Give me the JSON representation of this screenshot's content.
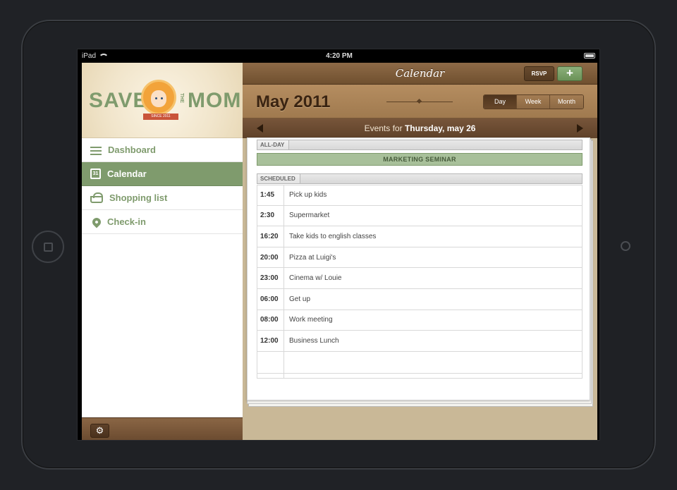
{
  "statusbar": {
    "carrier": "iPad",
    "time": "4:20 PM"
  },
  "logo": {
    "word_left": "SAVE",
    "word_the": "THE",
    "word_right": "MOM",
    "ribbon": "SINCE 2011"
  },
  "sidebar": {
    "items": [
      {
        "label": "Dashboard",
        "icon": "list-icon",
        "active": false
      },
      {
        "label": "Calendar",
        "icon": "calendar-icon",
        "icon_text": "31",
        "active": true
      },
      {
        "label": "Shopping list",
        "icon": "basket-icon",
        "active": false
      },
      {
        "label": "Check-in",
        "icon": "location-pin-icon",
        "active": false
      }
    ],
    "footer_icon": "gear-icon"
  },
  "header": {
    "title": "Calendar",
    "rsvp_label": "RSVP",
    "add_label": "+"
  },
  "month": {
    "title": "May 2011",
    "views": [
      "Day",
      "Week",
      "Month"
    ],
    "selected_view": "Day"
  },
  "events_bar": {
    "prefix": "Events for",
    "date": "Thursday, may 26"
  },
  "allday": {
    "header": "ALL-DAY",
    "event": "MARKETING SEMINAR"
  },
  "scheduled": {
    "header": "SCHEDULED",
    "rows": [
      {
        "time": "1:45",
        "event": "Pick up kids"
      },
      {
        "time": "2:30",
        "event": "Supermarket"
      },
      {
        "time": "16:20",
        "event": "Take kids to english classes"
      },
      {
        "time": "20:00",
        "event": "Pizza at Luigi's"
      },
      {
        "time": "23:00",
        "event": "Cinema w/ Louie"
      },
      {
        "time": "06:00",
        "event": "Get up"
      },
      {
        "time": "08:00",
        "event": "Work meeting"
      },
      {
        "time": "12:00",
        "event": "Business Lunch"
      }
    ]
  },
  "colors": {
    "accent_green": "#7f9b6d",
    "brown_bar": "#70502f",
    "allday_green": "#a8c09a"
  }
}
